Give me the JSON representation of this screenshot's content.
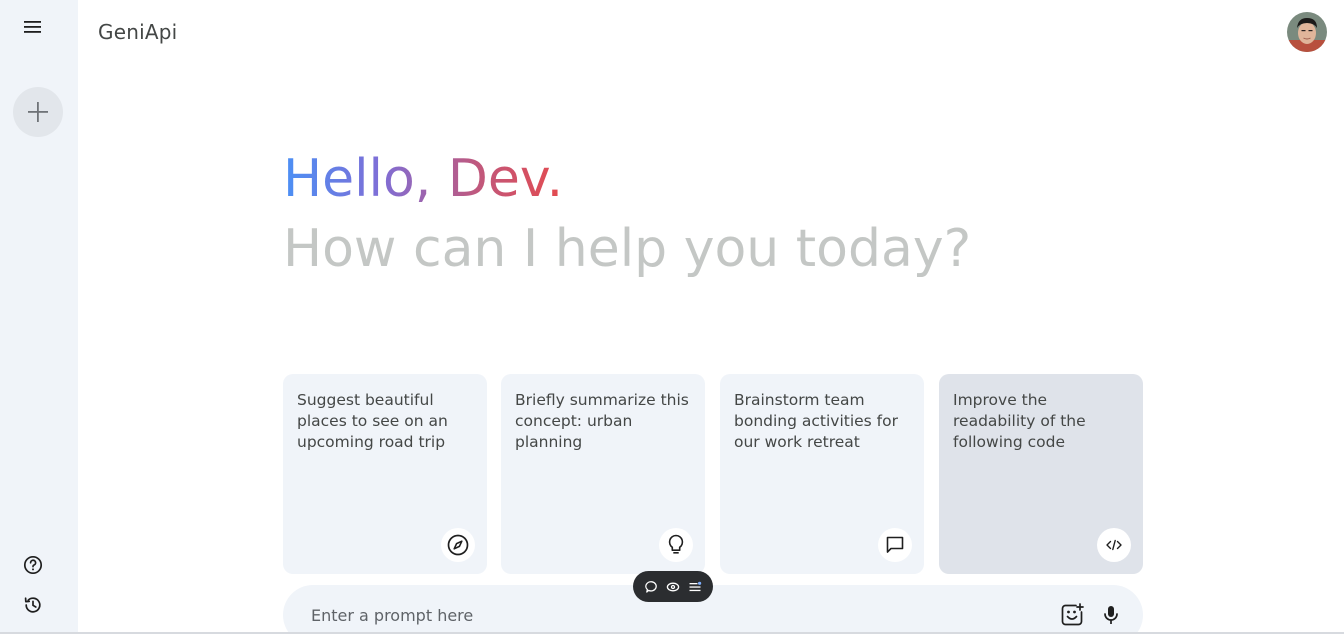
{
  "app": {
    "brand": "GeniApi"
  },
  "sidebar": {
    "menu_icon": "menu-icon",
    "new_chat_icon": "plus-icon",
    "help_icon": "help-icon",
    "history_icon": "history-icon"
  },
  "user": {
    "avatar": "user-avatar"
  },
  "greeting": {
    "hello": "Hello, Dev.",
    "subtitle": "How can I help you today?"
  },
  "cards": [
    {
      "text": "Suggest beautiful places to see on an upcoming road trip",
      "icon": "compass-icon"
    },
    {
      "text": "Briefly summarize this concept: urban planning",
      "icon": "lightbulb-icon"
    },
    {
      "text": "Brainstorm team bonding activities for our work retreat",
      "icon": "chat-bubble-icon"
    },
    {
      "text": "Improve the readability of the following code",
      "icon": "code-icon"
    }
  ],
  "prompt": {
    "placeholder": "Enter a prompt here",
    "gallery_icon": "image-add-icon",
    "mic_icon": "microphone-icon"
  },
  "floating_toolbar": {
    "icons": [
      "comment-icon",
      "eye-icon",
      "list-icon"
    ]
  },
  "colors": {
    "sidebar_bg": "#f0f4f9",
    "card_bg": "#f0f4f9",
    "card_active_bg": "#dfe3ea",
    "subtitle": "#c4c7c5",
    "gradient_start": "#4b90f5",
    "gradient_end": "#e44a4e"
  }
}
